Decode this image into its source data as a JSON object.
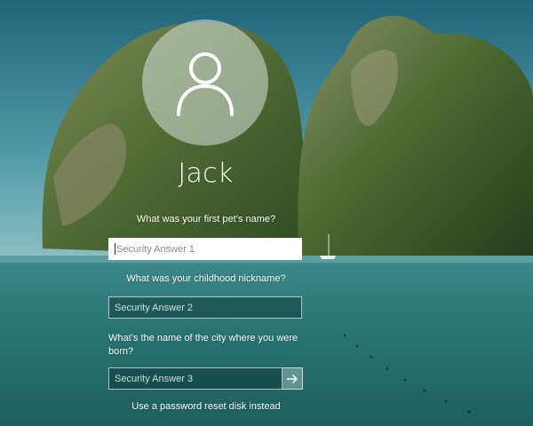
{
  "user": {
    "name": "Jack",
    "avatar_icon": "user-silhouette-icon"
  },
  "security_questions": [
    {
      "question": "What was your first pet’s name?",
      "placeholder": "Security Answer 1",
      "value": "",
      "focused": true
    },
    {
      "question": "What was your childhood nickname?",
      "placeholder": "Security Answer 2",
      "value": "",
      "focused": false
    },
    {
      "question": "What’s the name of the city where you were born?",
      "placeholder": "Security Answer 3",
      "value": "",
      "focused": false
    }
  ],
  "submit": {
    "icon": "arrow-right-icon"
  },
  "reset_link_text": "Use a password reset disk instead",
  "colors": {
    "sky": "#2f7d8c",
    "sea": "#1f6f6c",
    "field_border": "#ffffff",
    "text": "#ffffff"
  }
}
